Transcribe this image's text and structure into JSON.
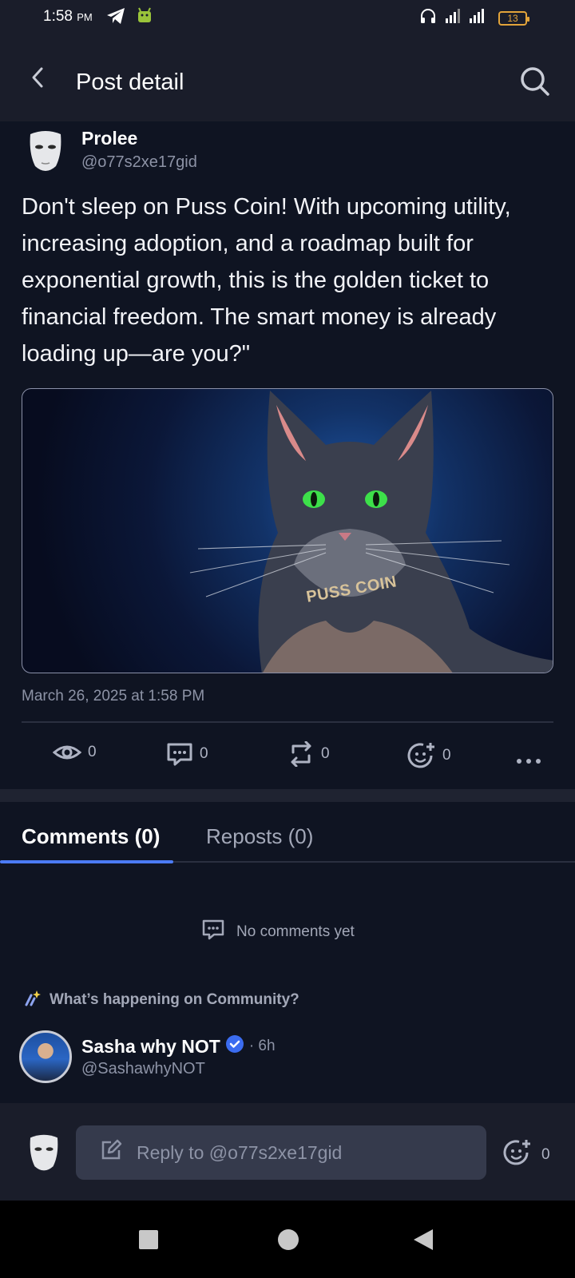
{
  "status_bar": {
    "time": "1:58",
    "ampm": "PM",
    "battery": "13"
  },
  "header": {
    "title": "Post detail"
  },
  "post": {
    "author_name": "Prolee",
    "author_handle": "@o77s2xe17gid",
    "text": "Don't sleep on Puss Coin! With upcoming utility, increasing adoption, and a roadmap built for exponential growth, this is the golden ticket to financial freedom. The smart money is already loading up—are you?\"",
    "image_label": "PUSS COIN",
    "timestamp": "March 26, 2025 at 1:58 PM",
    "stats": {
      "views": "0",
      "comments": "0",
      "reposts": "0",
      "reactions": "0"
    }
  },
  "tabs": {
    "comments": "Comments (0)",
    "reposts": "Reposts (0)"
  },
  "empty_state": {
    "text": "No comments yet"
  },
  "community": {
    "heading": "What’s happening on Community?",
    "post": {
      "name": "Sasha why NOT",
      "time": "· 6h",
      "handle": "@SashawhyNOT"
    }
  },
  "reply_bar": {
    "placeholder": "Reply to @o77s2xe17gid",
    "reaction_count": "0"
  },
  "colors": {
    "accent": "#4b7bf5",
    "background": "#0f1422",
    "header": "#1a1d2a",
    "muted_text": "#8d93a6"
  }
}
